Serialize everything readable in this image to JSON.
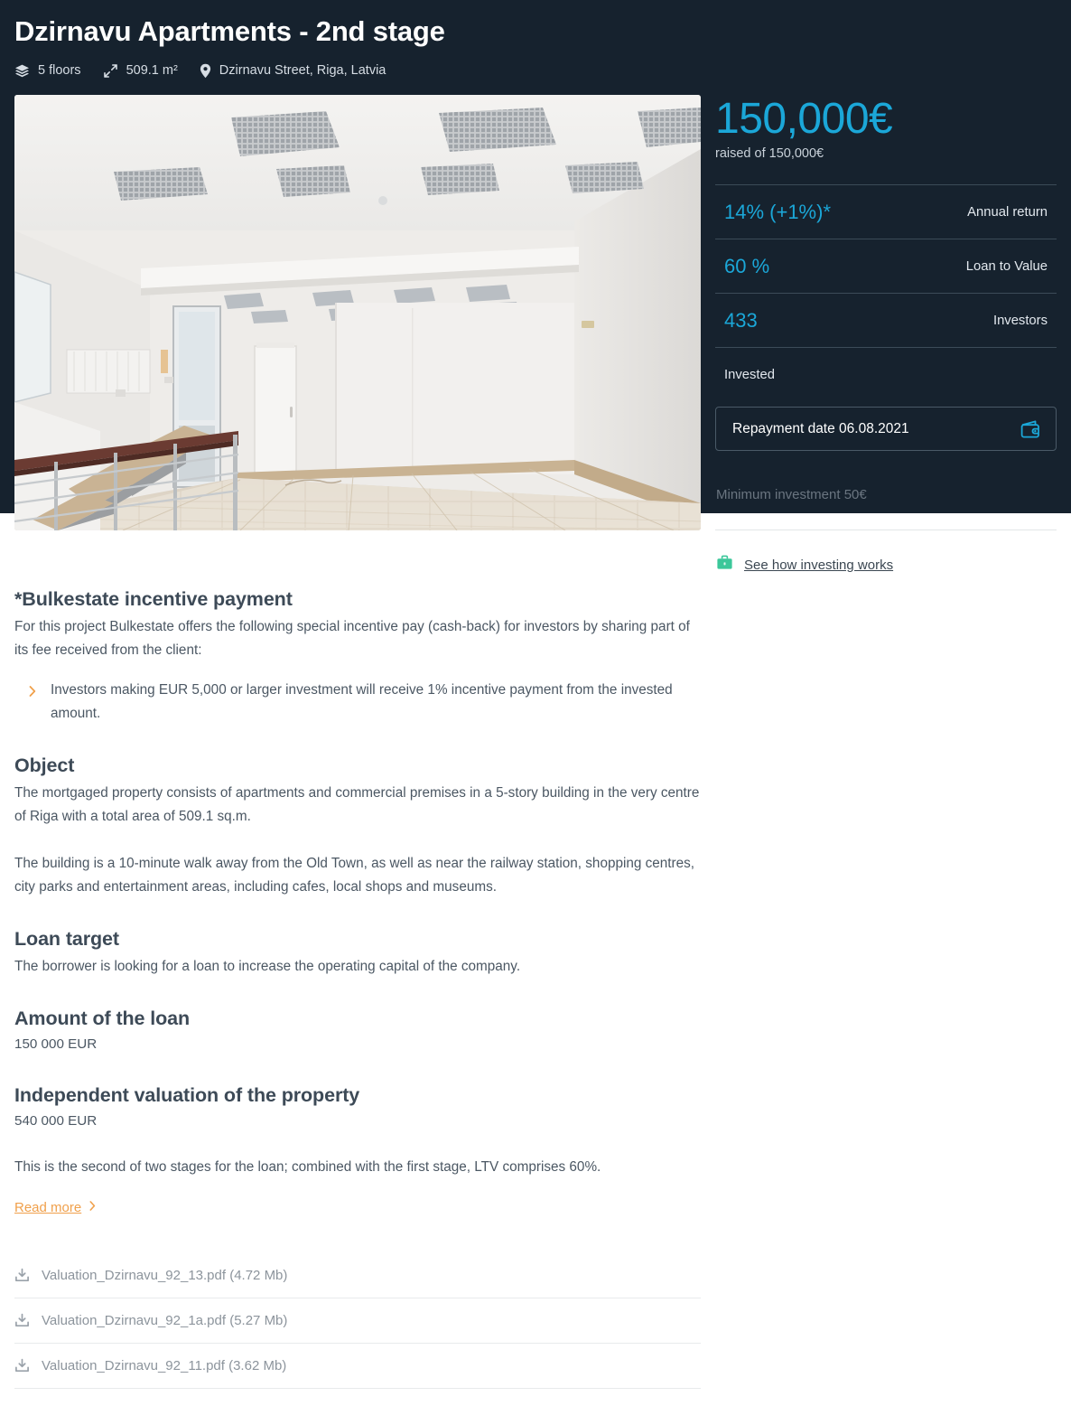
{
  "header": {
    "title": "Dzirnavu Apartments - 2nd stage",
    "meta": [
      {
        "icon": "layers-icon",
        "label": "5 floors"
      },
      {
        "icon": "expand-arrows-icon",
        "label": "509.1 m²"
      },
      {
        "icon": "map-pin-icon",
        "label": "Dzirnavu Street, Riga, Latvia"
      }
    ]
  },
  "gallery": {
    "image_alt": "Empty commercial interior with tiled floor, white walls, suspended ceiling lights and a staircase with handrail"
  },
  "sidebar": {
    "raised_amount": "150,000€",
    "raised_of": "raised of 150,000€",
    "stats": [
      {
        "value": "14% (+1%)*",
        "label": "Annual return"
      },
      {
        "value": "60 %",
        "label": "Loan to Value"
      },
      {
        "value": "433",
        "label": "Investors"
      }
    ],
    "status_label": "Invested",
    "repayment": {
      "text": "Repayment date 06.08.2021",
      "icon": "wallet-icon"
    },
    "minimum_investment": "Minimum investment 50€",
    "invest_link": {
      "icon": "briefcase-icon",
      "label": "See how investing works"
    }
  },
  "article": {
    "incentive": {
      "heading": "*Bulkestate incentive payment",
      "intro": "For this project Bulkestate offers the following special incentive pay (cash-back) for investors by sharing part of its fee received from the client:",
      "bullets": [
        "Investors making EUR 5,000 or larger investment will receive 1% incentive payment from the invested amount."
      ]
    },
    "object": {
      "heading": "Object",
      "paragraph_1": "The mortgaged property consists of apartments and commercial premises in a 5-story building in the very centre of Riga with a total area of 509.1 sq.m.",
      "paragraph_2": "The building is a 10-minute walk away from the Old Town, as well as near the railway station, shopping centres, city parks and entertainment areas, including cafes, local shops and museums."
    },
    "loan_target": {
      "heading": "Loan target",
      "paragraph": "The borrower is looking for a loan to increase the operating capital of the company."
    },
    "amount_of_loan": {
      "heading": "Amount of the loan",
      "value": "150 000 EUR"
    },
    "valuation": {
      "heading": "Independent valuation of the property",
      "value": "540 000 EUR"
    },
    "closing_note": "This is the second of two stages for the loan; combined with the first stage, LTV comprises 60%.",
    "read_more": "Read more"
  },
  "attachments": [
    {
      "name": "Valuation_Dzirnavu_92_13.pdf (4.72 Mb)"
    },
    {
      "name": "Valuation_Dzirnavu_92_1a.pdf (5.27 Mb)"
    },
    {
      "name": "Valuation_Dzirnavu_92_11.pdf (3.62 Mb)"
    }
  ],
  "colors": {
    "dark_panel": "#16222e",
    "accent_cyan": "#1ba7d8",
    "accent_orange": "#f0a04b",
    "accent_green": "#3bc79a",
    "body_text": "#4b5763",
    "heading_text": "#3d4a57"
  }
}
